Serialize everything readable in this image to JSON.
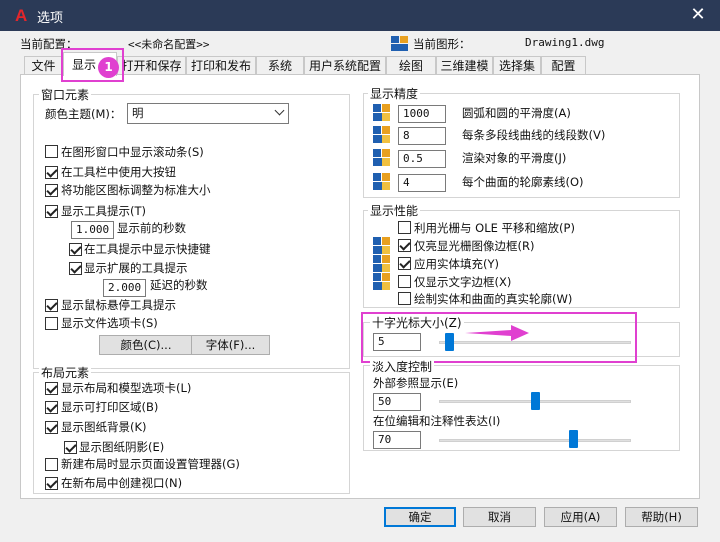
{
  "window": {
    "title": "选项",
    "close_glyph": "✕",
    "logo_glyph": "A"
  },
  "header": {
    "profile_label": "当前配置：",
    "profile_value": "<<未命名配置>>",
    "drawing_label": "当前图形：",
    "drawing_value": "Drawing1.dwg"
  },
  "tabs": [
    {
      "label": "文件"
    },
    {
      "label": "显示"
    },
    {
      "label": "打开和保存"
    },
    {
      "label": "打印和发布"
    },
    {
      "label": "系统"
    },
    {
      "label": "用户系统配置"
    },
    {
      "label": "绘图"
    },
    {
      "label": "三维建模"
    },
    {
      "label": "选择集"
    },
    {
      "label": "配置"
    }
  ],
  "annotation_badge": "1",
  "window_elements": {
    "title": "窗口元素",
    "color_theme_label": "颜色主题(M)：",
    "color_theme_value": "明",
    "options": [
      {
        "label": "在图形窗口中显示滚动条(S)",
        "checked": false
      },
      {
        "label": "在工具栏中使用大按钮",
        "checked": true
      },
      {
        "label": "将功能区图标调整为标准大小",
        "checked": true
      },
      {
        "label": "显示工具提示(T)",
        "checked": true
      }
    ],
    "tooltip_delay_value": "1.000",
    "tooltip_delay_label": "显示前的秒数",
    "show_shortcut_label": "在工具提示中显示快捷键",
    "show_extended_label": "显示扩展的工具提示",
    "extended_delay_value": "2.000",
    "extended_delay_label": "延迟的秒数",
    "rollover_label": "显示鼠标悬停工具提示",
    "file_tabs_label": "显示文件选项卡(S)",
    "colors_button": "颜色(C)...",
    "fonts_button": "字体(F)..."
  },
  "layout_elements": {
    "title": "布局元素",
    "options": [
      {
        "label": "显示布局和模型选项卡(L)",
        "checked": true
      },
      {
        "label": "显示可打印区域(B)",
        "checked": true
      },
      {
        "label": "显示图纸背景(K)",
        "checked": true
      }
    ],
    "paper_shadow_label": "显示图纸阴影(E)",
    "options2": [
      {
        "label": "新建布局时显示页面设置管理器(G)",
        "checked": false
      },
      {
        "label": "在新布局中创建视口(N)",
        "checked": true
      }
    ]
  },
  "resolution": {
    "title": "显示精度",
    "rows": [
      {
        "value": "1000",
        "label": "圆弧和圆的平滑度(A)"
      },
      {
        "value": "8",
        "label": "每条多段线曲线的线段数(V)"
      },
      {
        "value": "0.5",
        "label": "渲染对象的平滑度(J)"
      },
      {
        "value": "4",
        "label": "每个曲面的轮廓素线(O)"
      }
    ]
  },
  "performance": {
    "title": "显示性能",
    "options": [
      {
        "label": "利用光栅与 OLE 平移和缩放(P)",
        "checked": false,
        "icon": false
      },
      {
        "label": "仅亮显光栅图像边框(R)",
        "checked": true,
        "icon": true
      },
      {
        "label": "应用实体填充(Y)",
        "checked": true,
        "icon": true
      },
      {
        "label": "仅显示文字边框(X)",
        "checked": false,
        "icon": true
      },
      {
        "label": "绘制实体和曲面的真实轮廓(W)",
        "checked": false,
        "icon": false
      }
    ]
  },
  "crosshair": {
    "title": "十字光标大小(Z)",
    "value": "5",
    "slider_fraction": 0.05
  },
  "fade": {
    "title": "淡入度控制",
    "xref_label": "外部参照显示(E)",
    "xref_value": "50",
    "xref_fraction": 0.5,
    "inplace_label": "在位编辑和注释性表达(I)",
    "inplace_value": "70",
    "inplace_fraction": 0.7
  },
  "footer": {
    "ok": "确定",
    "cancel": "取消",
    "apply": "应用(A)",
    "help": "帮助(H)"
  },
  "colors": {
    "highlight": "#e040d0",
    "slider_thumb": "#0078d7",
    "titlebar": "#2b3a57",
    "logo": "#e3262b"
  },
  "icons": [
    "autocad-logo-icon",
    "close-icon",
    "drawing-file-icon",
    "resolution-setting-icon",
    "chevron-down-icon",
    "arrow-annotation-icon"
  ]
}
